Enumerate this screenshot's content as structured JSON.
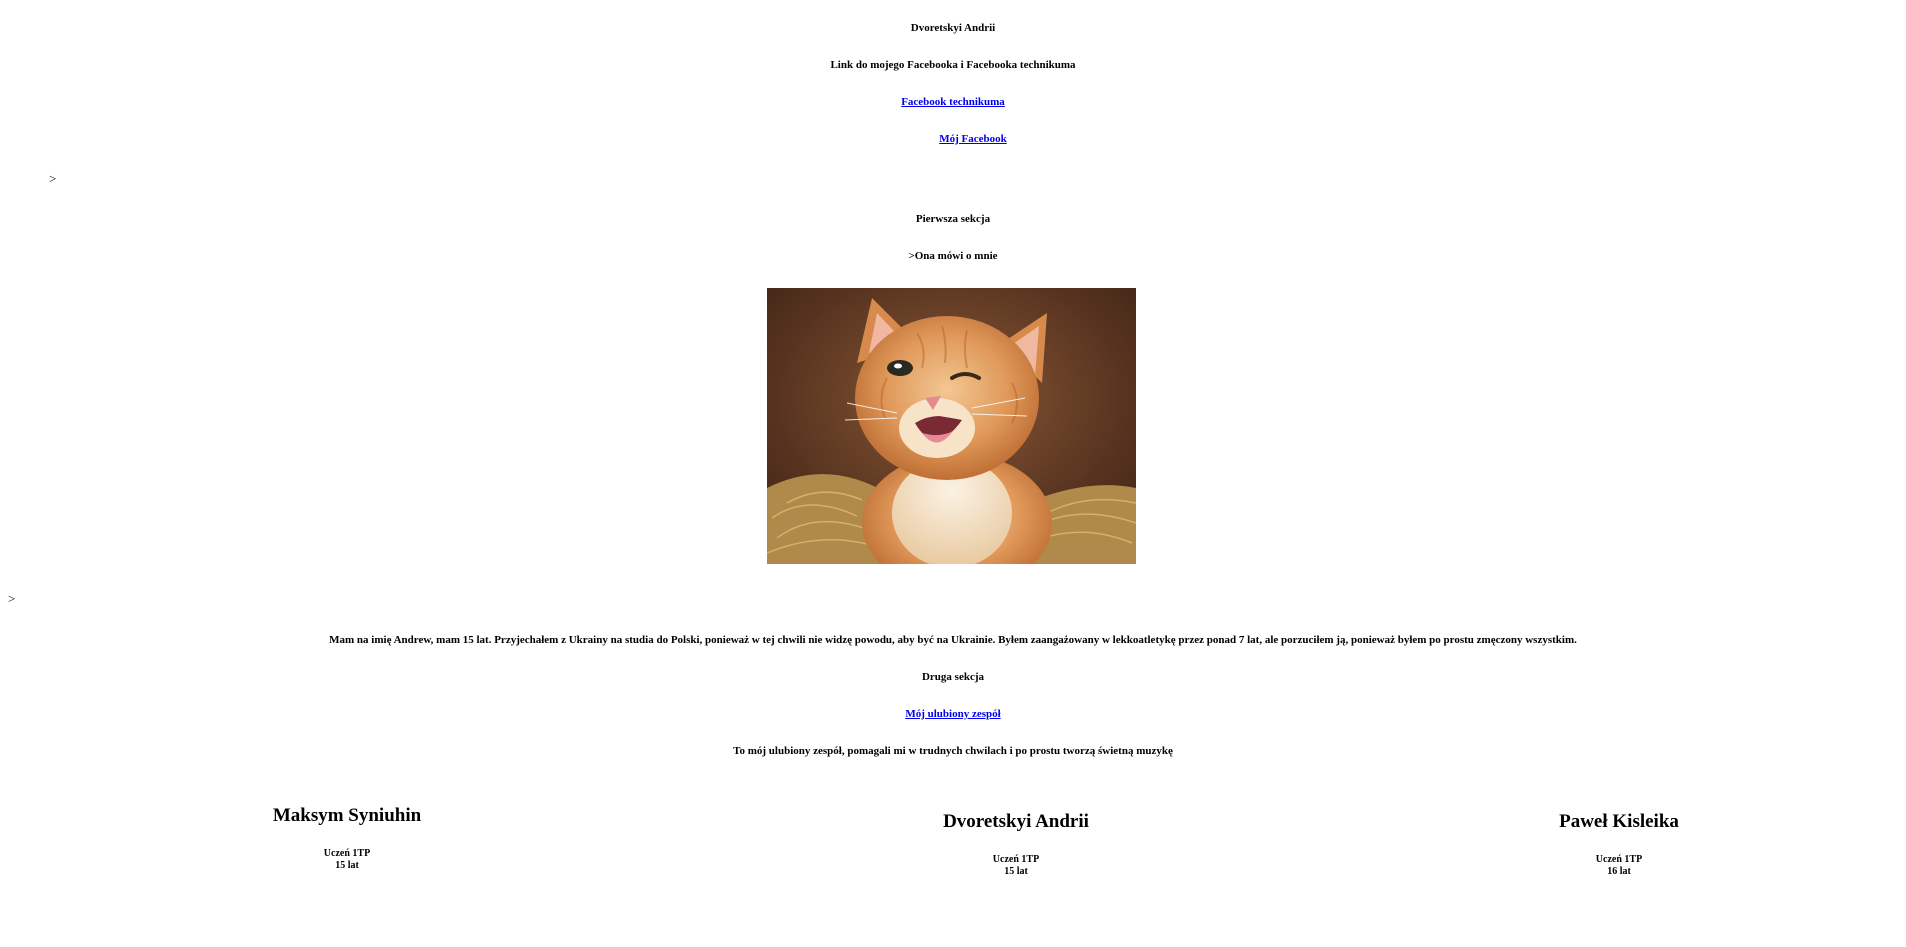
{
  "header": {
    "name": "Dvoretskyi Andrii",
    "links_heading": "Link do mojego Facebooka i Facebooka technikuma",
    "school_facebook_link": "Facebook technikuma",
    "my_facebook_link": "Mój Facebook"
  },
  "stray_marks": {
    "first": ">",
    "second": ">"
  },
  "section1": {
    "title": "Pierwsza sekcja",
    "subtitle": ">Ona mówi o mnie",
    "image_alt": "kitten"
  },
  "about": {
    "text": "Mam na imię Andrew, mam 15 lat. Przyjechałem z Ukrainy na studia do Polski, ponieważ w tej chwili nie widzę powodu, aby być na Ukrainie. Byłem zaangażowany w lekkoatletykę przez ponad 7 lat, ale porzuciłem ją, ponieważ byłem po prostu zmęczony wszystkim."
  },
  "section2": {
    "title": "Druga sekcja",
    "band_link": "Mój ulubiony zespół",
    "band_text": "To mój ulubiony zespół, pomagali mi w trudnych chwilach i po prostu tworzą świetną muzykę"
  },
  "people": [
    {
      "name": "Maksym Syniuhin",
      "role": "Uczeń 1TP",
      "age": "15 lat"
    },
    {
      "name": "Dvoretskyi Andrii",
      "role": "Uczeń 1TP",
      "age": "15 lat"
    },
    {
      "name": "Paweł Kisleika",
      "role": "Uczeń 1TP",
      "age": "16 lat"
    }
  ],
  "colors": {
    "link": "#0000ee",
    "text": "#000000",
    "background": "#ffffff"
  }
}
